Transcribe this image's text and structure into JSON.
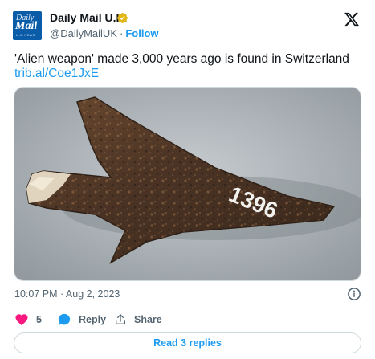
{
  "author": {
    "avatar_line1": "Daily",
    "avatar_line2": "Mail",
    "avatar_line3": "U.K. NEWS",
    "name": "Daily Mail U.K.",
    "handle": "@DailyMailUK",
    "separator": "·",
    "follow_label": "Follow",
    "verified_icon": "gold-verified-badge",
    "logo_icon": "x-logo"
  },
  "tweet": {
    "text": "'Alien weapon' made 3,000 years ago is found in Switzerland",
    "link": "trib.al/Coe1JxE",
    "image_alt": "Rusty meteorite-iron arrowhead labelled 1396",
    "image_label": "1396",
    "timestamp": "10:07 PM · Aug 2, 2023"
  },
  "actions": {
    "like_count": "5",
    "reply_label": "Reply",
    "share_label": "Share",
    "read_replies_label": "Read 3 replies"
  },
  "colors": {
    "accent": "#1d9bf0",
    "like": "#f91880",
    "muted": "#536471",
    "verified_gold": "#e2b719",
    "brand_blue": "#0b5ca8"
  }
}
